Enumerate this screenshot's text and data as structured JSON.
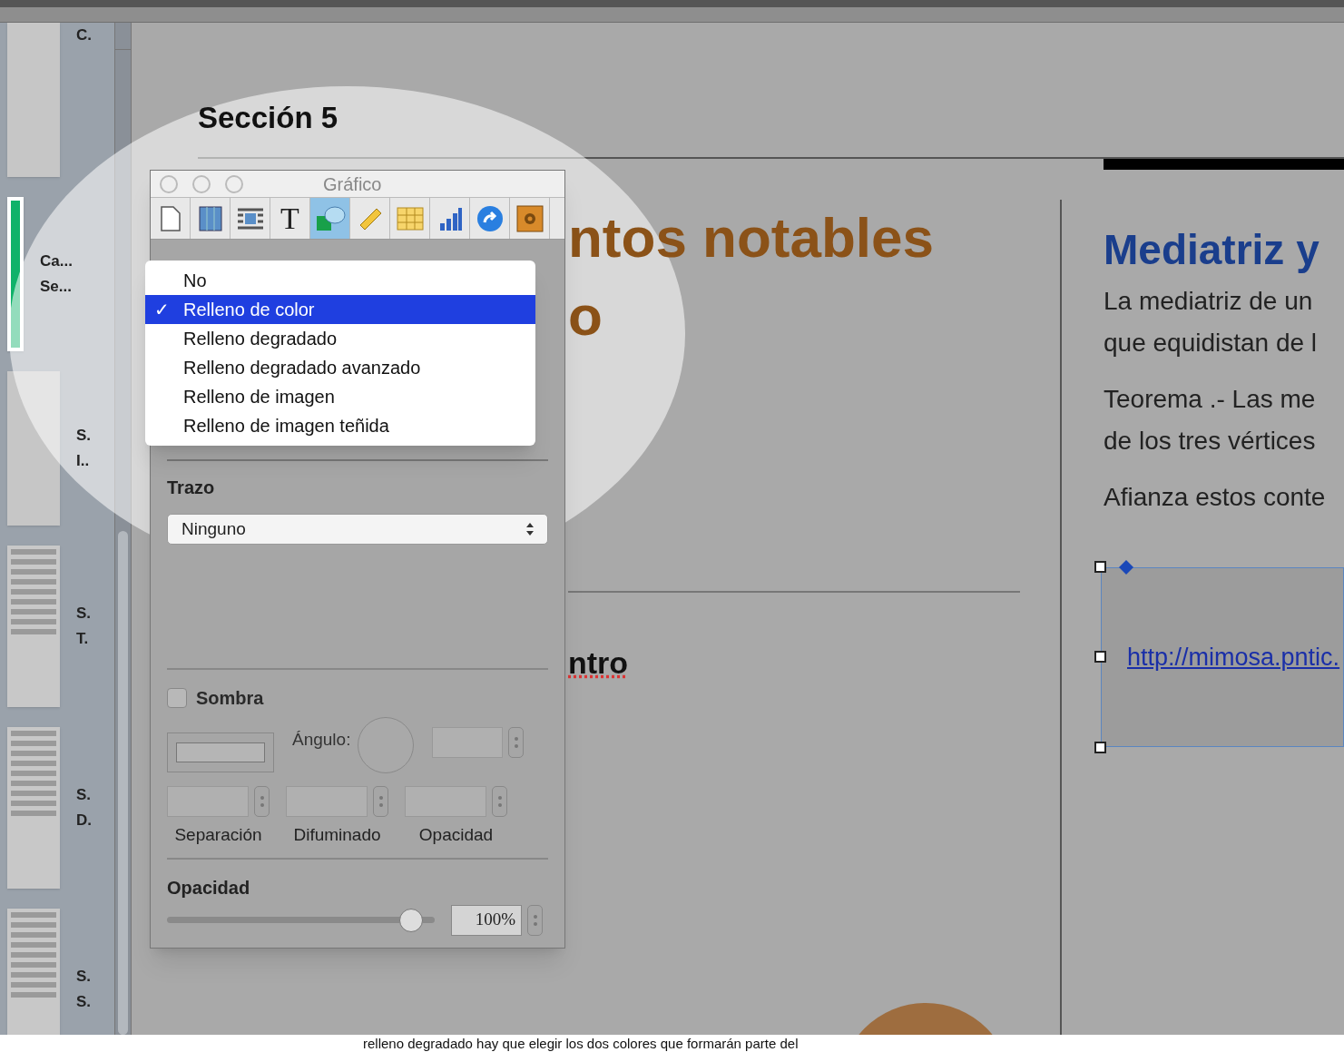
{
  "sidebar": {
    "items": [
      {
        "kind": "blank",
        "lines": [
          "C."
        ]
      },
      {
        "kind": "cover",
        "lines": [
          "Ca...",
          "Se..."
        ]
      },
      {
        "kind": "blank",
        "lines": [
          "S.",
          "I.."
        ]
      },
      {
        "kind": "text",
        "lines": [
          "S.",
          "T."
        ]
      },
      {
        "kind": "text",
        "lines": [
          "S.",
          "D."
        ]
      },
      {
        "kind": "text",
        "lines": [
          "S.",
          "S."
        ]
      }
    ]
  },
  "document": {
    "section_title": "Sección 5",
    "left_fragments": [
      {
        "kind": "title",
        "text": "ntos notables"
      },
      {
        "kind": "title",
        "text": "o"
      },
      {
        "kind": "rule"
      },
      {
        "kind": "subtitle",
        "text": "ntro"
      }
    ],
    "right_heading": "Mediatriz y",
    "right_paragraphs": [
      [
        "La mediatriz de un",
        "que equidistan de l"
      ],
      [
        "Teorema .- Las me",
        "de los tres vértices"
      ],
      [
        "Afianza estos conte"
      ]
    ],
    "link": "http://mimosa.pntic."
  },
  "inspector": {
    "title": "Gráfico",
    "tools": [
      {
        "kind": "document",
        "selected": false
      },
      {
        "kind": "layout",
        "selected": false
      },
      {
        "kind": "wrap",
        "selected": false
      },
      {
        "kind": "text",
        "glyph": "T",
        "selected": false
      },
      {
        "kind": "graphic",
        "selected": true
      },
      {
        "kind": "metrics",
        "selected": false
      },
      {
        "kind": "table",
        "selected": false
      },
      {
        "kind": "chart",
        "selected": false
      },
      {
        "kind": "link",
        "selected": false
      },
      {
        "kind": "media",
        "selected": false
      }
    ],
    "fill_menu": {
      "check": "✓",
      "items": [
        {
          "label": "No",
          "selected": false
        },
        {
          "label": "Relleno de color",
          "selected": true
        },
        {
          "label": "Relleno degradado",
          "selected": false
        },
        {
          "label": "Relleno degradado avanzado",
          "selected": false
        },
        {
          "label": "Relleno de imagen",
          "selected": false
        },
        {
          "label": "Relleno de imagen teñida",
          "selected": false
        }
      ]
    },
    "stroke": {
      "label": "Trazo",
      "value": "Ninguno"
    },
    "shadow": {
      "label": "Sombra",
      "checked": false,
      "angle_label": "Ángulo:",
      "fields": [
        "Separación",
        "Difuminado",
        "Opacidad"
      ]
    },
    "opacity": {
      "label": "Opacidad",
      "level": 0.95,
      "value": "100%"
    }
  },
  "caption": "relleno degradado hay que elegir los dos colores que formarán parte del"
}
